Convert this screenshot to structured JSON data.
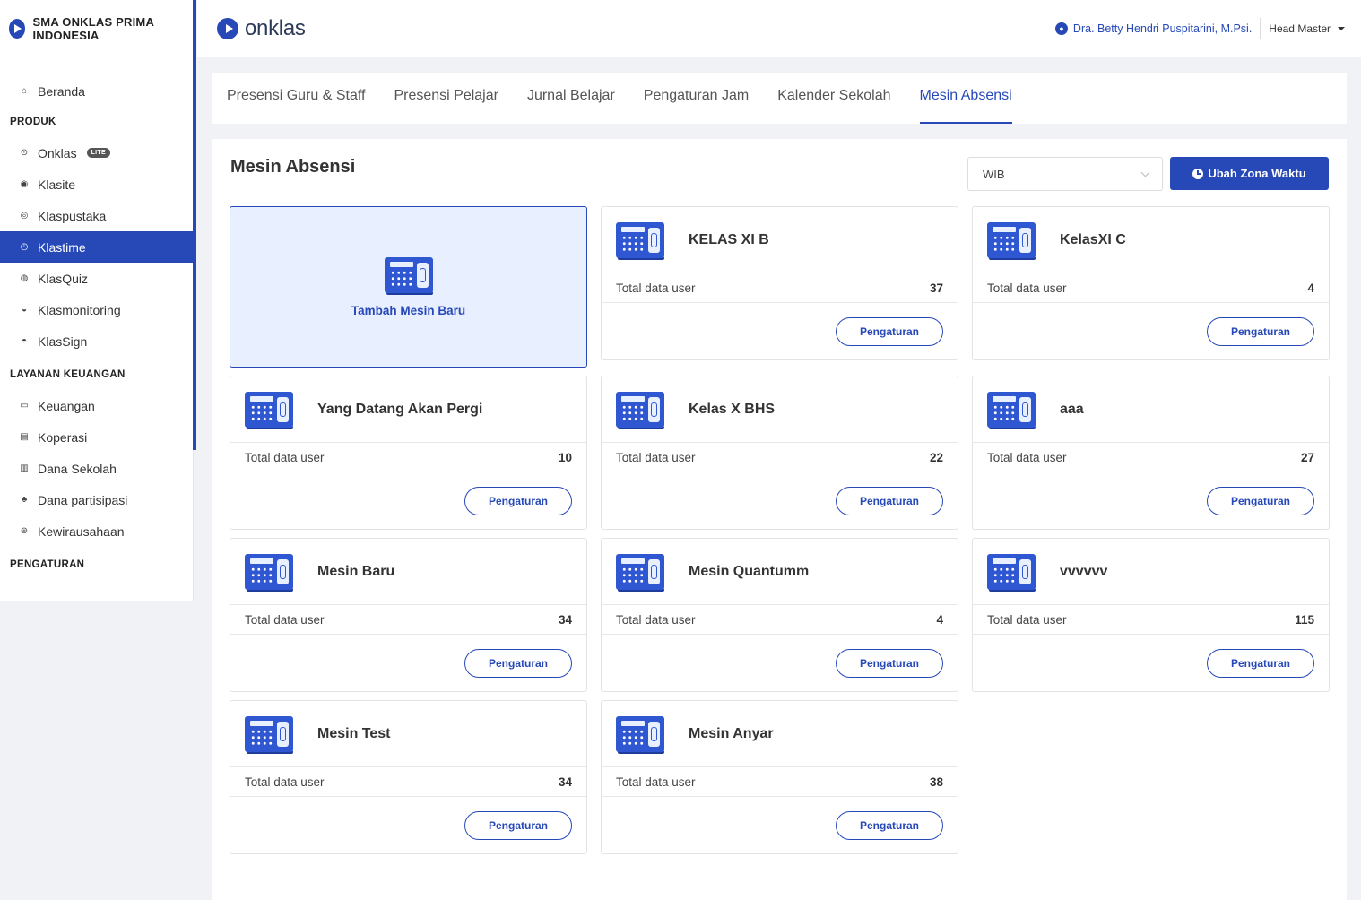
{
  "sidebar": {
    "brand_name": "SMA ONKLAS PRIMA INDONESIA",
    "home_label": "Beranda",
    "section_produk": "PRODUK",
    "produk_items": [
      {
        "label": "Onklas",
        "icon": "onklas-icon",
        "badge": "LITE"
      },
      {
        "label": "Klasite",
        "icon": "klasite-icon"
      },
      {
        "label": "Klaspustaka",
        "icon": "klaspustaka-icon"
      },
      {
        "label": "Klastime",
        "icon": "klastime-icon",
        "active": true
      },
      {
        "label": "KlasQuiz",
        "icon": "klasquiz-icon"
      },
      {
        "label": "Klasmonitoring",
        "icon": "klasmonitoring-icon"
      },
      {
        "label": "KlasSign",
        "icon": "klassign-icon"
      }
    ],
    "section_keuangan": "LAYANAN KEUANGAN",
    "keuangan_items": [
      {
        "label": "Keuangan",
        "icon": "wallet-icon"
      },
      {
        "label": "Koperasi",
        "icon": "store-icon"
      },
      {
        "label": "Dana Sekolah",
        "icon": "school-fund-icon"
      },
      {
        "label": "Dana partisipasi",
        "icon": "participation-icon"
      },
      {
        "label": "Kewirausahaan",
        "icon": "entrepreneur-icon"
      }
    ],
    "section_pengaturan": "PENGATURAN"
  },
  "topbar": {
    "logo_text": "onklas",
    "user_name": "Dra. Betty Hendri Puspitarini, M.Psi.",
    "role": "Head Master"
  },
  "tabs": [
    {
      "label": "Presensi Guru & Staff"
    },
    {
      "label": "Presensi Pelajar"
    },
    {
      "label": "Jurnal Belajar"
    },
    {
      "label": "Pengaturan Jam"
    },
    {
      "label": "Kalender Sekolah"
    },
    {
      "label": "Mesin Absensi",
      "active": true
    }
  ],
  "main": {
    "title": "Mesin Absensi",
    "timezone_value": "WIB",
    "timezone_button": "Ubah Zona Waktu",
    "add_machine_label": "Tambah Mesin Baru",
    "stat_label": "Total data user",
    "settings_label": "Pengaturan",
    "machines": [
      {
        "name": "KELAS XI B",
        "total": "37"
      },
      {
        "name": "KelasXI C",
        "total": "4"
      },
      {
        "name": "Yang Datang Akan Pergi",
        "total": "10"
      },
      {
        "name": "Kelas X BHS",
        "total": "22"
      },
      {
        "name": "aaa",
        "total": "27"
      },
      {
        "name": "Mesin Baru",
        "total": "34"
      },
      {
        "name": "Mesin Quantumm",
        "total": "4"
      },
      {
        "name": "vvvvvv",
        "total": "115"
      },
      {
        "name": "Mesin Test",
        "total": "34"
      },
      {
        "name": "Mesin Anyar",
        "total": "38"
      }
    ]
  },
  "colors": {
    "accent": "#2749b8",
    "accent_light": "#e8efff"
  }
}
